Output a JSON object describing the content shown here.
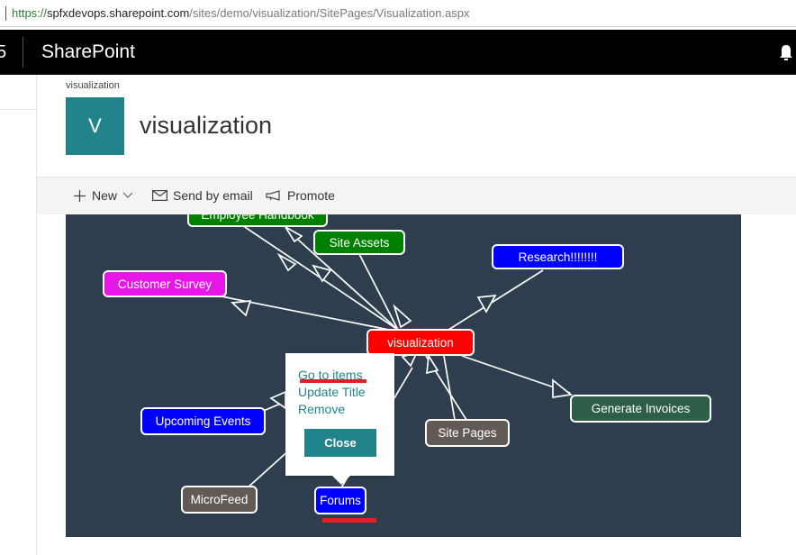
{
  "browser": {
    "url_protocol": "https://",
    "url_host": "spfxdevops.sharepoint.com",
    "url_path": "/sites/demo/visualization/SitePages/Visualization.aspx"
  },
  "suite": {
    "number_fragment": "5",
    "brand": "SharePoint",
    "icons": [
      "bell-icon"
    ]
  },
  "site": {
    "breadcrumb": "visualization",
    "logo_letter": "V",
    "logo_color": "#20848a",
    "title": "visualization"
  },
  "commands": {
    "new_label": "New",
    "send_label": "Send by email",
    "promote_label": "Promote",
    "icons": [
      "plus-icon",
      "chevron-down-icon",
      "mail-icon",
      "megaphone-icon"
    ]
  },
  "graph": {
    "background": "#2f3e4e",
    "center": "visualization",
    "nodes": [
      {
        "label": "Employee Handbook",
        "color": "#008000"
      },
      {
        "label": "Site Assets",
        "color": "#008000"
      },
      {
        "label": "Research!!!!!!!!",
        "color": "#0000ff"
      },
      {
        "label": "Customer Survey",
        "color": "#e617e6"
      },
      {
        "label": "visualization",
        "color": "#ff0000"
      },
      {
        "label": "Generate Invoices",
        "color": "#2d5e48"
      },
      {
        "label": "Upcoming Events",
        "color": "#0000ff"
      },
      {
        "label": "Site Pages",
        "color": "#625a55"
      },
      {
        "label": "MicroFeed",
        "color": "#625a55"
      },
      {
        "label": "Forums",
        "color": "#0000ff"
      }
    ]
  },
  "popup": {
    "links": [
      "Go to items",
      "Update Title",
      "Remove"
    ],
    "close_label": "Close",
    "highlight_color": "#e31e24"
  }
}
